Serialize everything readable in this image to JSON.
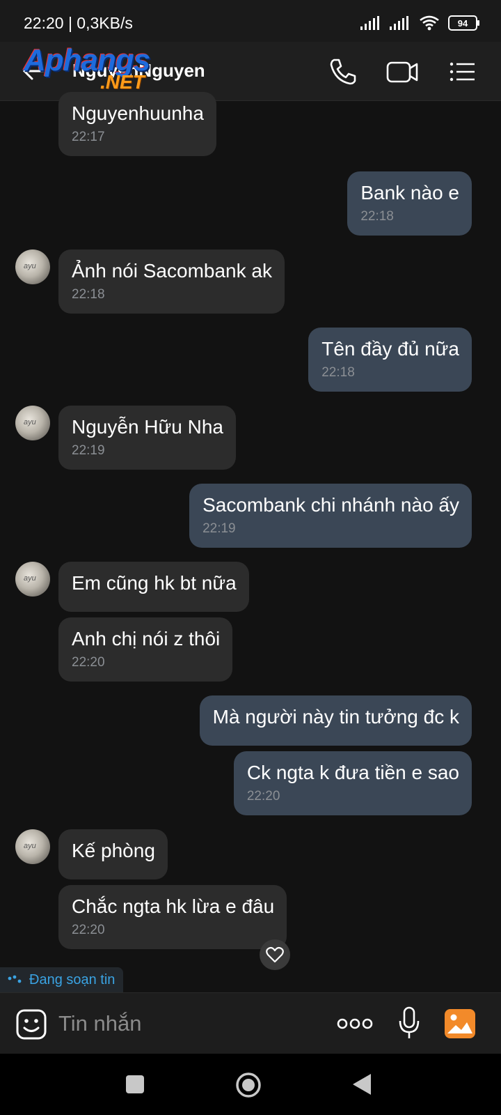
{
  "status": {
    "time_speed": "22:20 | 0,3KB/s",
    "battery": "94"
  },
  "header": {
    "contact_name": "NguyenNguyen",
    "watermark_main": "Aphangs",
    "watermark_sub": ".NET"
  },
  "messages": [
    {
      "dir": "in",
      "text": "Nguyenhuunha",
      "time": "22:17"
    },
    {
      "dir": "out",
      "text": "Bank nào e",
      "time": "22:18"
    },
    {
      "dir": "in",
      "text": "Ảnh nói Sacombank ak",
      "time": "22:18"
    },
    {
      "dir": "out",
      "text": "Tên đầy đủ nữa",
      "time": "22:18"
    },
    {
      "dir": "in",
      "text": "Nguyễn Hữu Nha",
      "time": "22:19"
    },
    {
      "dir": "out",
      "text": "Sacombank chi nhánh nào ấy",
      "time": "22:19"
    },
    {
      "dir": "in",
      "text": "Em cũng hk bt nữa",
      "time": ""
    },
    {
      "dir": "in",
      "text": "Anh chị nói z thôi",
      "time": "22:20"
    },
    {
      "dir": "out",
      "text": "Mà người này tin tưởng đc k",
      "time": ""
    },
    {
      "dir": "out",
      "text": "Ck ngta k đưa tiền e sao",
      "time": "22:20"
    },
    {
      "dir": "in",
      "text": "Kế phòng",
      "time": ""
    },
    {
      "dir": "in",
      "text": "Chắc ngta hk lừa e đâu",
      "time": "22:20"
    }
  ],
  "typing_indicator": "Đang soạn tin",
  "composer": {
    "placeholder": "Tin nhắn"
  },
  "icons": {
    "back": "back-arrow-icon",
    "call": "phone-icon",
    "video": "video-call-icon",
    "menu": "list-menu-icon",
    "emoji": "emoji-icon",
    "more": "more-icon",
    "mic": "microphone-icon",
    "gallery": "gallery-icon",
    "heart": "heart-icon"
  },
  "colors": {
    "incoming_bubble": "#2c2c2c",
    "outgoing_bubble": "#3b4756",
    "accent": "#3aa3e3",
    "gallery": "#f28a2a"
  }
}
